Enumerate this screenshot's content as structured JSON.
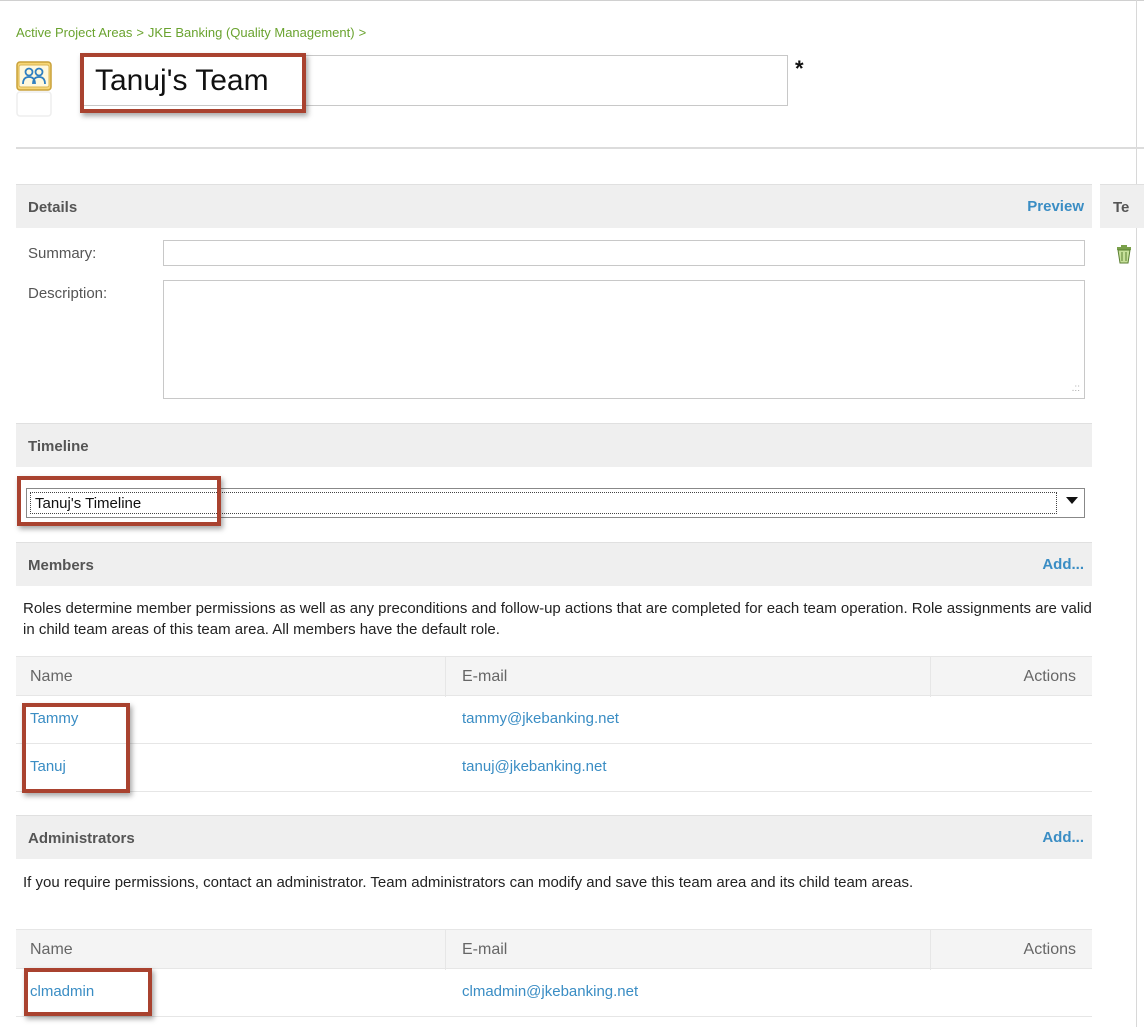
{
  "breadcrumb": {
    "items": [
      "Active Project Areas",
      "JKE Banking (Quality Management)"
    ],
    "separator": ">"
  },
  "team": {
    "name": "Tanuj's Team",
    "required_mark": "*",
    "icon": "team-people-icon"
  },
  "details": {
    "title": "Details",
    "preview_label": "Preview",
    "summary_label": "Summary:",
    "summary_value": "",
    "description_label": "Description:",
    "description_value": ""
  },
  "side_panel": {
    "title": "Te",
    "icon": "trash-icon"
  },
  "timeline": {
    "title": "Timeline",
    "selected": "Tanuj's Timeline"
  },
  "members": {
    "title": "Members",
    "add_label": "Add...",
    "help": "Roles determine member permissions as well as any preconditions and follow-up actions that are completed for each team operation. Role assignments are valid in child team areas of this team area. All members have the default role.",
    "columns": {
      "name": "Name",
      "email": "E-mail",
      "actions": "Actions"
    },
    "rows": [
      {
        "name": "Tammy",
        "email": "tammy@jkebanking.net"
      },
      {
        "name": "Tanuj",
        "email": "tanuj@jkebanking.net"
      }
    ]
  },
  "administrators": {
    "title": "Administrators",
    "add_label": "Add...",
    "help": "If you require permissions, contact an administrator. Team administrators can modify and save this team area and its child team areas.",
    "columns": {
      "name": "Name",
      "email": "E-mail",
      "actions": "Actions"
    },
    "rows": [
      {
        "name": "clmadmin",
        "email": "clmadmin@jkebanking.net"
      }
    ]
  },
  "colors": {
    "link": "#3a8dc4",
    "breadcrumb": "#6aa32f",
    "callout": "#a9422f",
    "section_bg": "#efefef"
  }
}
